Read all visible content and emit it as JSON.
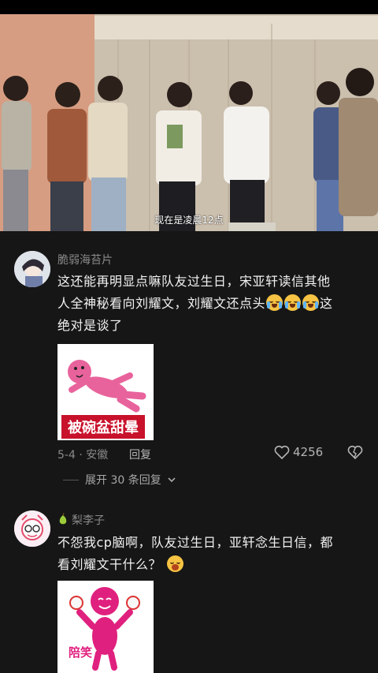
{
  "video": {
    "subtitle": "现在是凌晨12点"
  },
  "comments": [
    {
      "username": "脆弱海苔片",
      "text_line1": "这还能再明显点嘛队友过生日，宋亚轩读信其他",
      "text_line2": "人全神秘看向刘耀文，刘耀文还点头",
      "text_line2_tail": "这",
      "text_line3": "绝对是谈了",
      "emojis": [
        "crying-laughing-emoji",
        "crying-laughing-emoji",
        "crying-laughing-emoji"
      ],
      "sticker_label": "被碗盆甜晕",
      "date_location": "5-4 · 安徽",
      "reply_label": "回复",
      "like_count": "4256",
      "expand_label": "展开 30 条回复"
    },
    {
      "username": "梨李子",
      "text_line1": "不怨我cp脑啊，队友过生日，亚轩念生日信，都",
      "text_line2": "看刘耀文干什么？",
      "emojis": [
        "yawning-emoji"
      ],
      "sticker_label": "陪笑"
    }
  ],
  "colors": {
    "background": "#161616",
    "text": "#f2f2f2",
    "muted": "#8a8a8a",
    "sticker_red": "#c8112b",
    "sticker_pink": "#e8639c"
  }
}
